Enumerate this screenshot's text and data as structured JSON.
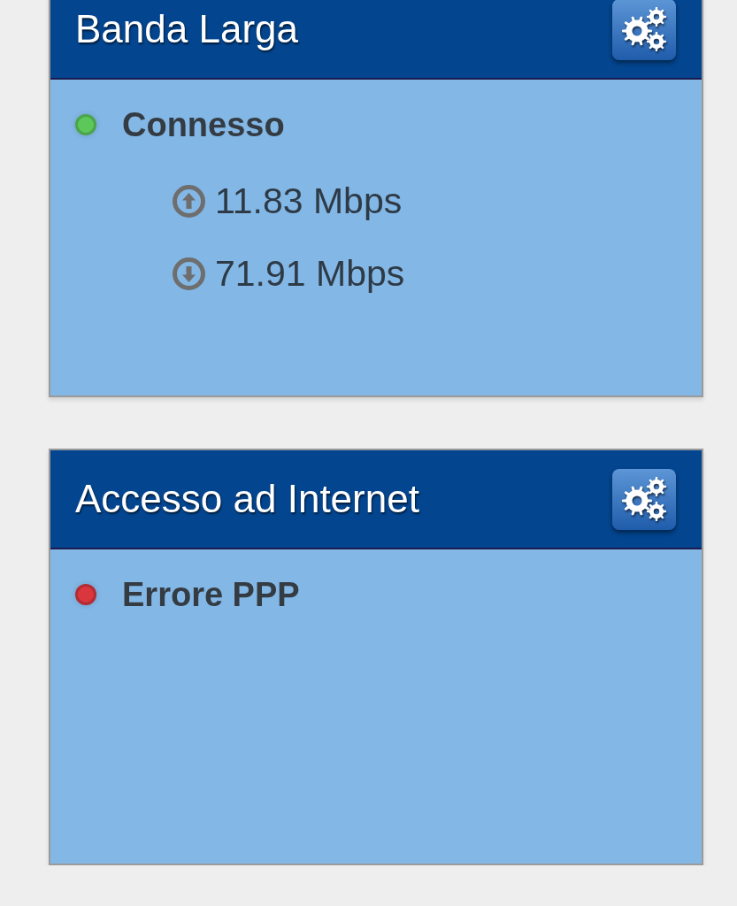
{
  "panels": [
    {
      "title": "Banda Larga",
      "status": {
        "label": "Connesso",
        "color": "#5cc85a"
      },
      "speeds": [
        {
          "kind": "up",
          "value": "11.83 Mbps"
        },
        {
          "kind": "down",
          "value": "71.91 Mbps"
        }
      ]
    },
    {
      "title": "Accesso ad Internet",
      "status": {
        "label": "Errore PPP",
        "color": "#d9363e"
      }
    }
  ]
}
